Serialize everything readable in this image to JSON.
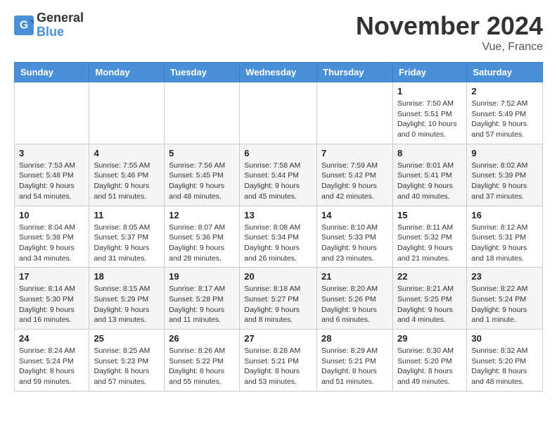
{
  "logo": {
    "line1": "General",
    "line2": "Blue"
  },
  "title": "November 2024",
  "location": "Vue, France",
  "weekdays": [
    "Sunday",
    "Monday",
    "Tuesday",
    "Wednesday",
    "Thursday",
    "Friday",
    "Saturday"
  ],
  "weeks": [
    [
      {
        "day": "",
        "info": ""
      },
      {
        "day": "",
        "info": ""
      },
      {
        "day": "",
        "info": ""
      },
      {
        "day": "",
        "info": ""
      },
      {
        "day": "",
        "info": ""
      },
      {
        "day": "1",
        "info": "Sunrise: 7:50 AM\nSunset: 5:51 PM\nDaylight: 10 hours and 0 minutes."
      },
      {
        "day": "2",
        "info": "Sunrise: 7:52 AM\nSunset: 5:49 PM\nDaylight: 9 hours and 57 minutes."
      }
    ],
    [
      {
        "day": "3",
        "info": "Sunrise: 7:53 AM\nSunset: 5:48 PM\nDaylight: 9 hours and 54 minutes."
      },
      {
        "day": "4",
        "info": "Sunrise: 7:55 AM\nSunset: 5:46 PM\nDaylight: 9 hours and 51 minutes."
      },
      {
        "day": "5",
        "info": "Sunrise: 7:56 AM\nSunset: 5:45 PM\nDaylight: 9 hours and 48 minutes."
      },
      {
        "day": "6",
        "info": "Sunrise: 7:58 AM\nSunset: 5:44 PM\nDaylight: 9 hours and 45 minutes."
      },
      {
        "day": "7",
        "info": "Sunrise: 7:59 AM\nSunset: 5:42 PM\nDaylight: 9 hours and 42 minutes."
      },
      {
        "day": "8",
        "info": "Sunrise: 8:01 AM\nSunset: 5:41 PM\nDaylight: 9 hours and 40 minutes."
      },
      {
        "day": "9",
        "info": "Sunrise: 8:02 AM\nSunset: 5:39 PM\nDaylight: 9 hours and 37 minutes."
      }
    ],
    [
      {
        "day": "10",
        "info": "Sunrise: 8:04 AM\nSunset: 5:38 PM\nDaylight: 9 hours and 34 minutes."
      },
      {
        "day": "11",
        "info": "Sunrise: 8:05 AM\nSunset: 5:37 PM\nDaylight: 9 hours and 31 minutes."
      },
      {
        "day": "12",
        "info": "Sunrise: 8:07 AM\nSunset: 5:36 PM\nDaylight: 9 hours and 28 minutes."
      },
      {
        "day": "13",
        "info": "Sunrise: 8:08 AM\nSunset: 5:34 PM\nDaylight: 9 hours and 26 minutes."
      },
      {
        "day": "14",
        "info": "Sunrise: 8:10 AM\nSunset: 5:33 PM\nDaylight: 9 hours and 23 minutes."
      },
      {
        "day": "15",
        "info": "Sunrise: 8:11 AM\nSunset: 5:32 PM\nDaylight: 9 hours and 21 minutes."
      },
      {
        "day": "16",
        "info": "Sunrise: 8:12 AM\nSunset: 5:31 PM\nDaylight: 9 hours and 18 minutes."
      }
    ],
    [
      {
        "day": "17",
        "info": "Sunrise: 8:14 AM\nSunset: 5:30 PM\nDaylight: 9 hours and 16 minutes."
      },
      {
        "day": "18",
        "info": "Sunrise: 8:15 AM\nSunset: 5:29 PM\nDaylight: 9 hours and 13 minutes."
      },
      {
        "day": "19",
        "info": "Sunrise: 8:17 AM\nSunset: 5:28 PM\nDaylight: 9 hours and 11 minutes."
      },
      {
        "day": "20",
        "info": "Sunrise: 8:18 AM\nSunset: 5:27 PM\nDaylight: 9 hours and 8 minutes."
      },
      {
        "day": "21",
        "info": "Sunrise: 8:20 AM\nSunset: 5:26 PM\nDaylight: 9 hours and 6 minutes."
      },
      {
        "day": "22",
        "info": "Sunrise: 8:21 AM\nSunset: 5:25 PM\nDaylight: 9 hours and 4 minutes."
      },
      {
        "day": "23",
        "info": "Sunrise: 8:22 AM\nSunset: 5:24 PM\nDaylight: 9 hours and 1 minute."
      }
    ],
    [
      {
        "day": "24",
        "info": "Sunrise: 8:24 AM\nSunset: 5:24 PM\nDaylight: 8 hours and 59 minutes."
      },
      {
        "day": "25",
        "info": "Sunrise: 8:25 AM\nSunset: 5:23 PM\nDaylight: 8 hours and 57 minutes."
      },
      {
        "day": "26",
        "info": "Sunrise: 8:26 AM\nSunset: 5:22 PM\nDaylight: 8 hours and 55 minutes."
      },
      {
        "day": "27",
        "info": "Sunrise: 8:28 AM\nSunset: 5:21 PM\nDaylight: 8 hours and 53 minutes."
      },
      {
        "day": "28",
        "info": "Sunrise: 8:29 AM\nSunset: 5:21 PM\nDaylight: 8 hours and 51 minutes."
      },
      {
        "day": "29",
        "info": "Sunrise: 8:30 AM\nSunset: 5:20 PM\nDaylight: 8 hours and 49 minutes."
      },
      {
        "day": "30",
        "info": "Sunrise: 8:32 AM\nSunset: 5:20 PM\nDaylight: 8 hours and 48 minutes."
      }
    ]
  ]
}
